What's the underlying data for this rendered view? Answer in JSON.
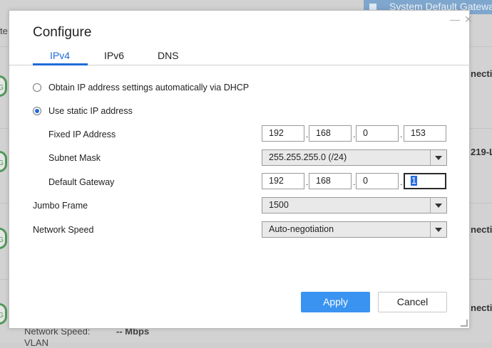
{
  "background": {
    "top_button_label": "System Default Gateway",
    "left_fragment": "te",
    "right_fragments": [
      "nectio",
      "219-L",
      "nectio",
      "nectio"
    ],
    "badge_letter": "G",
    "bottom_label": "Network Speed:",
    "bottom_value": "-- Mbps",
    "bottom_cut_label": "VLAN"
  },
  "dialog": {
    "title": "Configure",
    "controls": {
      "minimize": "—",
      "close": "✕"
    },
    "tabs": [
      {
        "label": "IPv4",
        "active": true
      },
      {
        "label": "IPv6",
        "active": false
      },
      {
        "label": "DNS",
        "active": false
      }
    ],
    "dhcp_option": {
      "label": "Obtain IP address settings automatically via DHCP",
      "checked": false
    },
    "static_option": {
      "label": "Use static IP address",
      "checked": true
    },
    "fixed_ip": {
      "label": "Fixed IP Address",
      "octets": [
        "192",
        "168",
        "0",
        "153"
      ]
    },
    "subnet_mask": {
      "label": "Subnet Mask",
      "value": "255.255.255.0 (/24)"
    },
    "default_gateway": {
      "label": "Default Gateway",
      "octets": [
        "192",
        "168",
        "0",
        "1"
      ]
    },
    "jumbo_frame": {
      "label": "Jumbo Frame",
      "value": "1500"
    },
    "network_speed": {
      "label": "Network Speed",
      "value": "Auto-negotiation"
    },
    "buttons": {
      "apply": "Apply",
      "cancel": "Cancel"
    },
    "octet_separator": "."
  },
  "colors": {
    "accent": "#1f6bd8",
    "apply_button": "#3a93f0",
    "badge": "#4f9a58"
  }
}
